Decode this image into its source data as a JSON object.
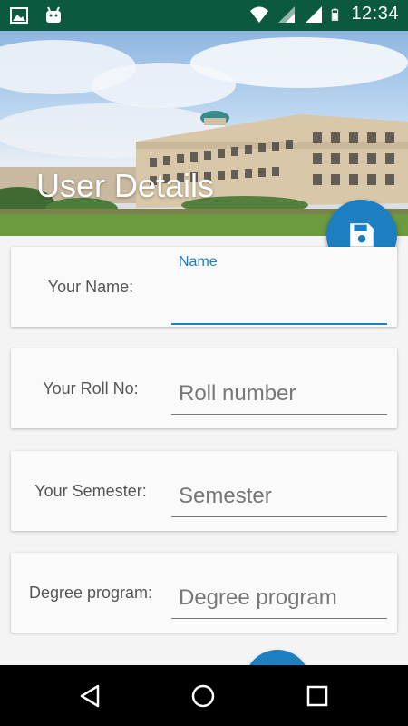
{
  "status_bar": {
    "time": "12:34",
    "icons": [
      "image-icon",
      "android-icon",
      "wifi-icon",
      "signal-icon",
      "signal-icon",
      "battery-icon"
    ]
  },
  "header": {
    "title": "User Details"
  },
  "form": {
    "fields": [
      {
        "label": "Your Name:",
        "floating_label": "Name",
        "value": "",
        "placeholder": ""
      },
      {
        "label": "Your Roll No:",
        "placeholder": "Roll number"
      },
      {
        "label": "Your Semester:",
        "placeholder": "Semester"
      },
      {
        "label": "Degree program:",
        "placeholder": "Degree program"
      }
    ]
  },
  "fab": {
    "icon": "save-icon"
  },
  "nav": {
    "icons": [
      "back-icon",
      "home-icon",
      "recents-icon"
    ]
  },
  "colors": {
    "status_bar": "#0b5a3f",
    "accent": "#1e7fc0",
    "nav_bar": "#000000"
  }
}
